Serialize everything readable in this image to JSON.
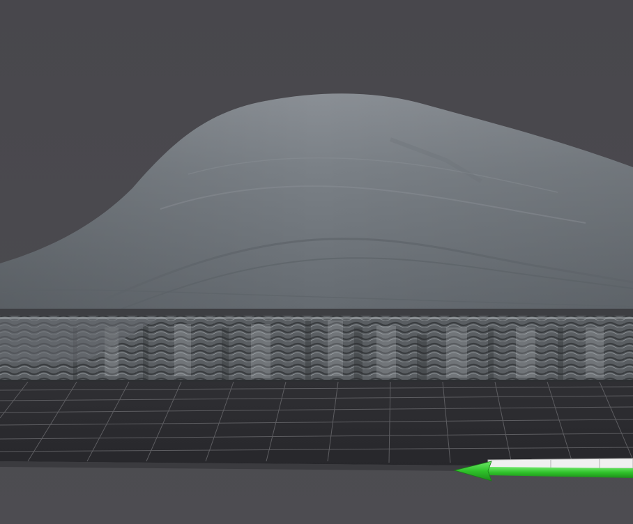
{
  "viewport": {
    "view_mode": "3d-perspective-preview",
    "background_color": "#4a494e",
    "model_color": "#7c8288",
    "toolpath_color": "#606468",
    "bed_color": "#2b2b2f",
    "grid_line_color": "#5d5d61",
    "axis_colors": {
      "x_axis": "#3fd13a",
      "y_axis": "#e6e6e6"
    }
  },
  "scene_objects": [
    {
      "id": "model-surface",
      "icon": "smooth-model-shell"
    },
    {
      "id": "printed-layers",
      "icon": "wavy-toolpath-layers"
    },
    {
      "id": "build-plate",
      "icon": "grid-plane"
    },
    {
      "id": "axis-gizmo",
      "icon": "arrow-axis-indicator"
    }
  ]
}
